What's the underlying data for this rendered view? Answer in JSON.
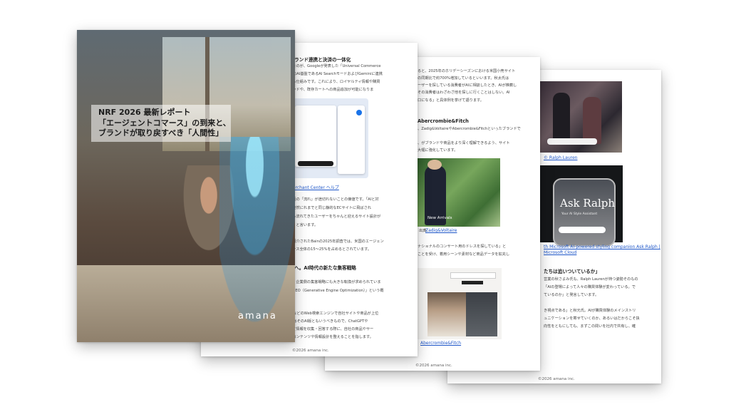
{
  "cover": {
    "title_lines": [
      "NRF 2026 最新レポート",
      "「エージェントコマース」の到来と、",
      "ブランドが取り戻すべき「人間性」"
    ],
    "logo": "amana"
  },
  "page2": {
    "heading_top": "：ブランド連携と決済の一体化",
    "lines_a": [
      "化したのが、Googleが発表した「Universal Commerce",
      "ogleのAI基盤であるAI SearchモードおよびGeminiに連携",
      "できる仕組みです。これにより、ロイヤルティ情報や購買",
      "コメンドや、既存カートへの商品追加が可能になりま"
    ],
    "caption_link": "e Merchant Center ヘルプ",
    "lines_b": [
      "の対話の「流れ」が途切れないことの価値です。「AIと対",
      "ー、突然にれまでと同じ静的なECサイトに飛ばされ",
      "AIから流れてきたユーザーをちゃんと迎えるサイト設計が",
      "くる」と言います。"
    ],
    "lines_c": [
      "内で紹介されたBainの2025年調査では、米国のエージェン",
      "コマース全体の15〜25%を占めるとされています。"
    ],
    "heading_mid": "化）へ。AI時代の新たな集客戦略",
    "lines_d": [
      "中で、企業側の集客戦略にも大きな転換が求められていま",
      "が「GEO（Generative Engine Optimization）」という概"
    ],
    "lines_e": [
      "ogleなどのWeb検索エンジンで自社サイトや商品が上位",
      "GEOはそのAI版ともいうべきもので、ChatGPTや",
      "対して情報を収集・回答する際に、自社の商品やサー",
      "トのコンテンツや情報設計を整えることを指します。"
    ],
    "footer": "©2026 amana inc."
  },
  "page3": {
    "lines_a": [
      "ると、2025年のホリデーシーズンにおける米国小売サイト",
      "の同期比で約700%増加しているといいます。秋太氏は",
      "ーザーを探している消費者がAIに相談したとき、AIが推薦し",
      "その消費者はわざわざ他を探しに行くことはしない。AI",
      "口になる」と具体例を挙げて語ります。"
    ],
    "heading": "Abercrombie&Fitch",
    "lines_b": [
      "、Zadig&VoltaireやAbercrombie&Fitchといったブランドで",
      "、がブランドや商品をより深く理解できるよう、サイト",
      "大幅に強化しています。"
    ],
    "photo_caption_prefix": "出典：",
    "photo_caption_link": "Zadig&Voltaire",
    "photo_badge": "New Arrivals",
    "lines_c": [
      "ナショナルのコンサート用のドレスを探している」と",
      "ことを受け、着用シーンや素材など商品データを拡充し"
    ],
    "caption_link_2": "Abercrombie&Fitch",
    "footer": "©2026 amana inc."
  },
  "page4": {
    "caption_link_1": "© Ralph Lauren",
    "phone_title": "Ask Ralph",
    "phone_sub": "Your AI Style Assistant",
    "caption_link_2a": "th Microsoft AI-powered styling companion Ask Ralph |",
    "caption_link_2b": "Microsoft Cloud",
    "heading": "たちは追いついているか」",
    "lines_a": [
      "営業の秋さよみ氏も、Ralph Laurenが持つ姿勢そのもの",
      "「AIの登場によって人々の購買体験が変わっている。で",
      "ているのか」と発言しています。"
    ],
    "lines_b": [
      "き視点である」と秋元氏。AIが購買体験のメインストリ",
      "ュニケーションを寄せていくのか、あるいはだからこそ抉",
      "向性をともにしても、まずこの問いを社内で共有し、確"
    ],
    "footer": "©2026 amana inc."
  },
  "colors": {
    "link": "#1f57c9",
    "page_bg": "#ffffff"
  }
}
